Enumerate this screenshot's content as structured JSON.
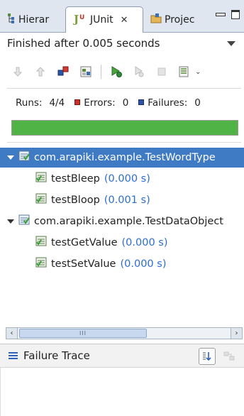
{
  "tabs": [
    {
      "label": "Hierar"
    },
    {
      "label": "JUnit",
      "close": "✕"
    },
    {
      "label": "Projec"
    }
  ],
  "status": {
    "text": "Finished after 0.005 seconds"
  },
  "counters": {
    "runs_label": "Runs:",
    "runs_value": "4/4",
    "errors_label": "Errors:",
    "errors_value": "0",
    "failures_label": "Failures:",
    "failures_value": "0"
  },
  "progress": {
    "fraction": 1.0,
    "color": "#4fb346"
  },
  "tree": {
    "suites": [
      {
        "name": "com.arapiki.example.TestWordType",
        "selected": true,
        "tests": [
          {
            "name": "testBleep",
            "time": "(0.000 s)"
          },
          {
            "name": "testBloop",
            "time": "(0.001 s)"
          }
        ]
      },
      {
        "name": "com.arapiki.example.TestDataObject",
        "selected": false,
        "tests": [
          {
            "name": "testGetValue",
            "time": "(0.000 s)"
          },
          {
            "name": "testSetValue",
            "time": "(0.000 s)"
          }
        ]
      }
    ]
  },
  "scrollbar": {
    "thumb_grip": "III",
    "left_arrow": "‹",
    "right_arrow": "›"
  },
  "failure_trace": {
    "title": "Failure Trace"
  },
  "colors": {
    "selection": "#3f7ac4",
    "time_text": "#2b6ed1",
    "error_badge": "#c8322d",
    "failure_badge": "#2c55a8"
  },
  "icons": [
    "hierarchy-icon",
    "junit-icon",
    "package-icon",
    "minimize-icon",
    "maximize-icon",
    "view-menu-icon",
    "next-failure-icon",
    "previous-failure-icon",
    "show-failures-only-icon",
    "scroll-lock-icon",
    "rerun-icon",
    "rerun-failed-first-icon",
    "stop-icon",
    "history-icon",
    "test-suite-icon",
    "test-case-icon",
    "filter-stack-icon",
    "compare-icon"
  ]
}
